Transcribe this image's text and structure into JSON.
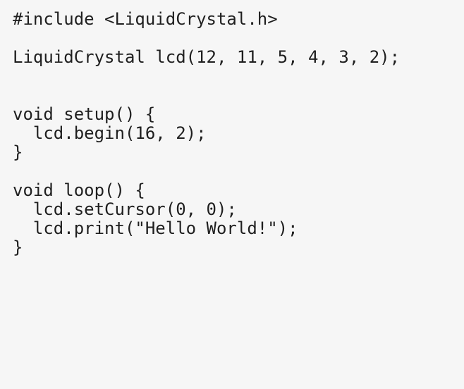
{
  "code": {
    "lines": [
      "#include <LiquidCrystal.h>",
      "LiquidCrystal lcd(12, 11, 5, 4, 3, 2);",
      "void setup() {",
      "  lcd.begin(16, 2);",
      "}",
      "void loop() {",
      "  lcd.setCursor(0, 0);",
      "  lcd.print(\"Hello World!\");",
      "}"
    ]
  }
}
